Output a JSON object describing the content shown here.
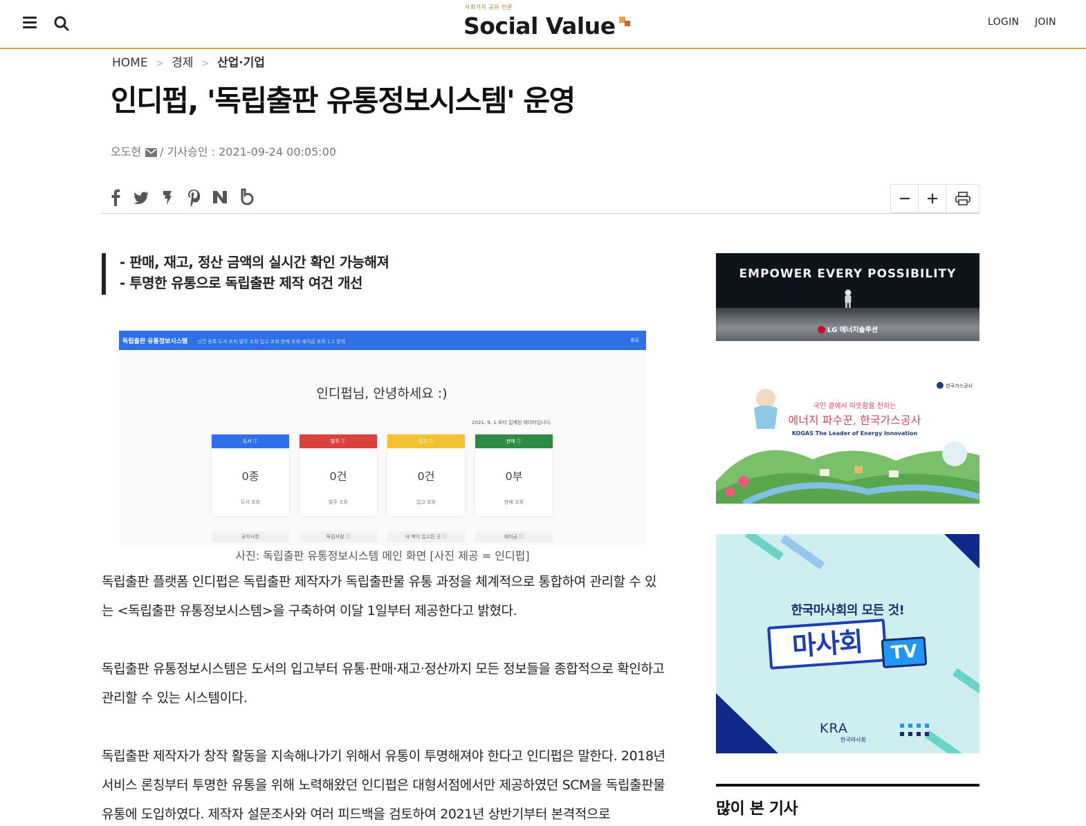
{
  "header": {
    "logo_tagline": "사회가치 공유 언론",
    "logo_text": "Social Value",
    "login_label": "LOGIN",
    "join_label": "JOIN",
    "accent_color": "#d9a441"
  },
  "breadcrumb": {
    "items": [
      "HOME",
      "경제",
      "산업·기업"
    ]
  },
  "article": {
    "title": "인디펍, '독립출판 유통정보시스템' 운영",
    "author": "오도현",
    "approved": "/ 기사승인 : 2021-09-24 00:05:00",
    "summary": [
      "- 판매, 재고, 정산 금액의 실시간 확인 가능해져",
      "- 투명한 유통으로 독립출판 제작 여건 개선"
    ],
    "caption": "사진: 독립출판 유통정보시스템 메인 화면 [사진 제공 = 인디펍]",
    "paragraphs": [
      "독립출판 플랫폼 인디펍은 독립출판 제작자가 독립출판물 유통 과정을 체계적으로 통합하여 관리할 수 있는 <독립출판 유통정보시스템>을 구축하여 이달 1일부터 제공한다고 밝혔다.",
      "독립출판 유통정보시스템은 도서의 입고부터 유통·판매·재고·정산까지 모든 정보들을 종합적으로 확인하고 관리할 수 있는 시스템이다.",
      "독립출판 제작자가 창작 활동을 지속해나가기 위해서 유통이 투명해져야 한다고 인디펍은 말한다. 2018년 서비스 론칭부터 투명한 유통을 위해 노력해왔던 인디펍은 대형서점에서만 제공하였던 SCM을 독립출판물 유통에 도입하였다. 제작자 설문조사와 여러 피드백을 검토하여 2021년 상반기부터 본격적으로"
    ]
  },
  "share": {
    "icons": [
      "facebook-icon",
      "twitter-icon",
      "kakaostory-icon",
      "pinterest-icon",
      "naver-icon",
      "band-icon"
    ]
  },
  "tools": {
    "icons": [
      "zoom-out-icon",
      "zoom-in-icon",
      "print-icon"
    ]
  },
  "photo": {
    "bar_title": "독립출판 유통정보시스템",
    "bar_menu": "신간 등록   도서 조회   발주 조회   입고 조회   판매 조회   예치금 조회   1:1 문의",
    "bar_right": "종료",
    "greeting": "인디펍님, 안녕하세요 :)",
    "note": "2021. 9. 1.부터 집계된 데이터입니다.",
    "cards": [
      {
        "header": "도서 ⓘ",
        "value": "0종",
        "sub": "도서 조회",
        "color": "#2f6fe8",
        "pill": "공지사항"
      },
      {
        "header": "발주 ⓘ",
        "value": "0건",
        "sub": "발주 조회",
        "color": "#d9413f",
        "pill": "독립서점 ⓘ"
      },
      {
        "header": "입고 ⓘ",
        "value": "0건",
        "sub": "입고 조회",
        "color": "#f2c233",
        "pill": "내 책이 입고된 곳 ⓘ"
      },
      {
        "header": "판매 ⓘ",
        "value": "0부",
        "sub": "판매 조회",
        "color": "#2f8a43",
        "pill": "예치금 ⓘ"
      }
    ]
  },
  "sidebar": {
    "ad1": {
      "text": "EMPOWER EVERY POSSIBILITY",
      "brand": "LG 에너지솔루션"
    },
    "ad2": {
      "line1": "국민 곁에서 따뜻함을 전하는",
      "line2": "에너지 파수꾼, 한국가스공사",
      "line3": "KOGAS The Leader of Energy Innovation",
      "corner": "한국가스공사"
    },
    "ad3": {
      "line1": "한국마사회의 모든 것!",
      "badge": "마사회",
      "tv": "TV",
      "brand": "KRA",
      "brand_sub": "한국마사회"
    },
    "popular_title": "많이 본 기사"
  }
}
